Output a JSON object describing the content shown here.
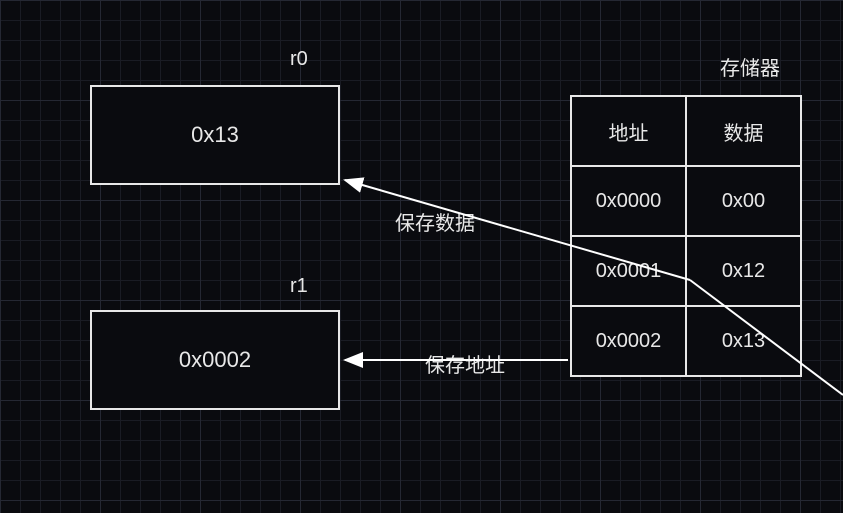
{
  "registers": {
    "r0": {
      "name": "r0",
      "value": "0x13"
    },
    "r1": {
      "name": "r1",
      "value": "0x0002"
    }
  },
  "memory": {
    "title": "存储器",
    "header": {
      "addr": "地址",
      "data": "数据"
    },
    "rows": [
      {
        "addr": "0x0000",
        "data": "0x00"
      },
      {
        "addr": "0x0001",
        "data": "0x12"
      },
      {
        "addr": "0x0002",
        "data": "0x13"
      }
    ]
  },
  "annotations": {
    "save_data": "保存数据",
    "save_addr": "保存地址"
  }
}
